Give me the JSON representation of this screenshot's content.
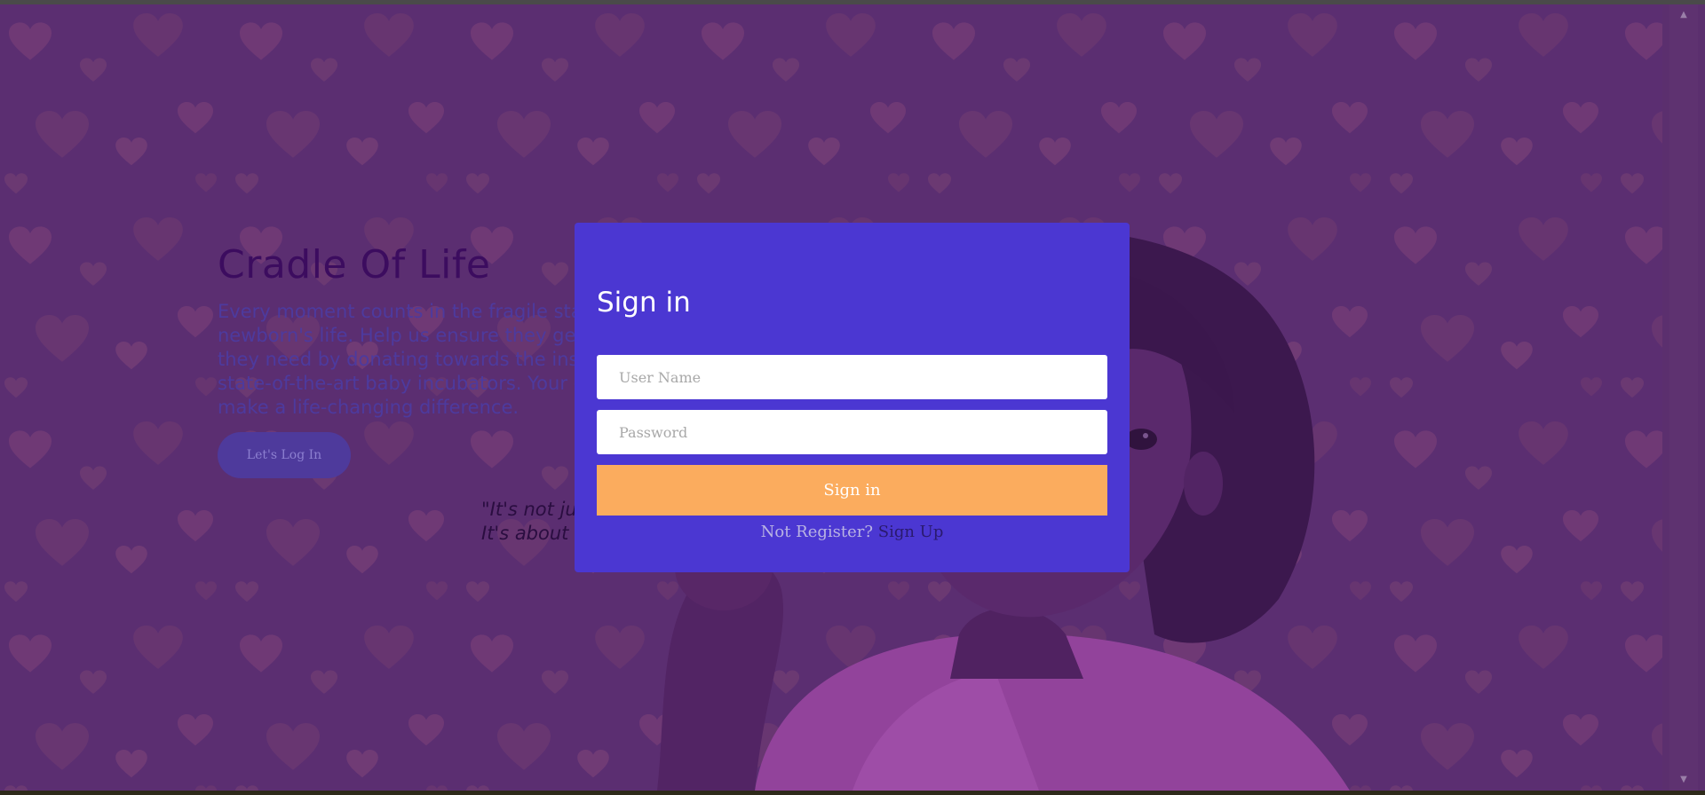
{
  "hero": {
    "title": "Cradle Of Life",
    "text": "Every moment counts in the fragile start of a newborn's life. Help us ensure they get the vital care they need by donating towards the installation of state-of-the-art baby incubators. Your generosity can make a life-changing difference.",
    "button_label": "Let's Log In",
    "quote": "\"It's not just about giving,\nIt's about giving life.\""
  },
  "modal": {
    "title": "Sign in",
    "username_placeholder": "User Name",
    "password_placeholder": "Password",
    "submit_label": "Sign in",
    "register_prompt": "Not Register?",
    "signup_link": "Sign Up"
  },
  "scrollbar": {
    "up_icon": "▲",
    "down_icon": "▼"
  },
  "colors": {
    "page_bg": "#5b2f6e",
    "modal_bg": "#4b37d2",
    "accent_button": "#fbac5e",
    "hero_title": "#3c0c5f",
    "hero_text": "#4d3a9e",
    "hero_button": "#4e3a9c"
  }
}
